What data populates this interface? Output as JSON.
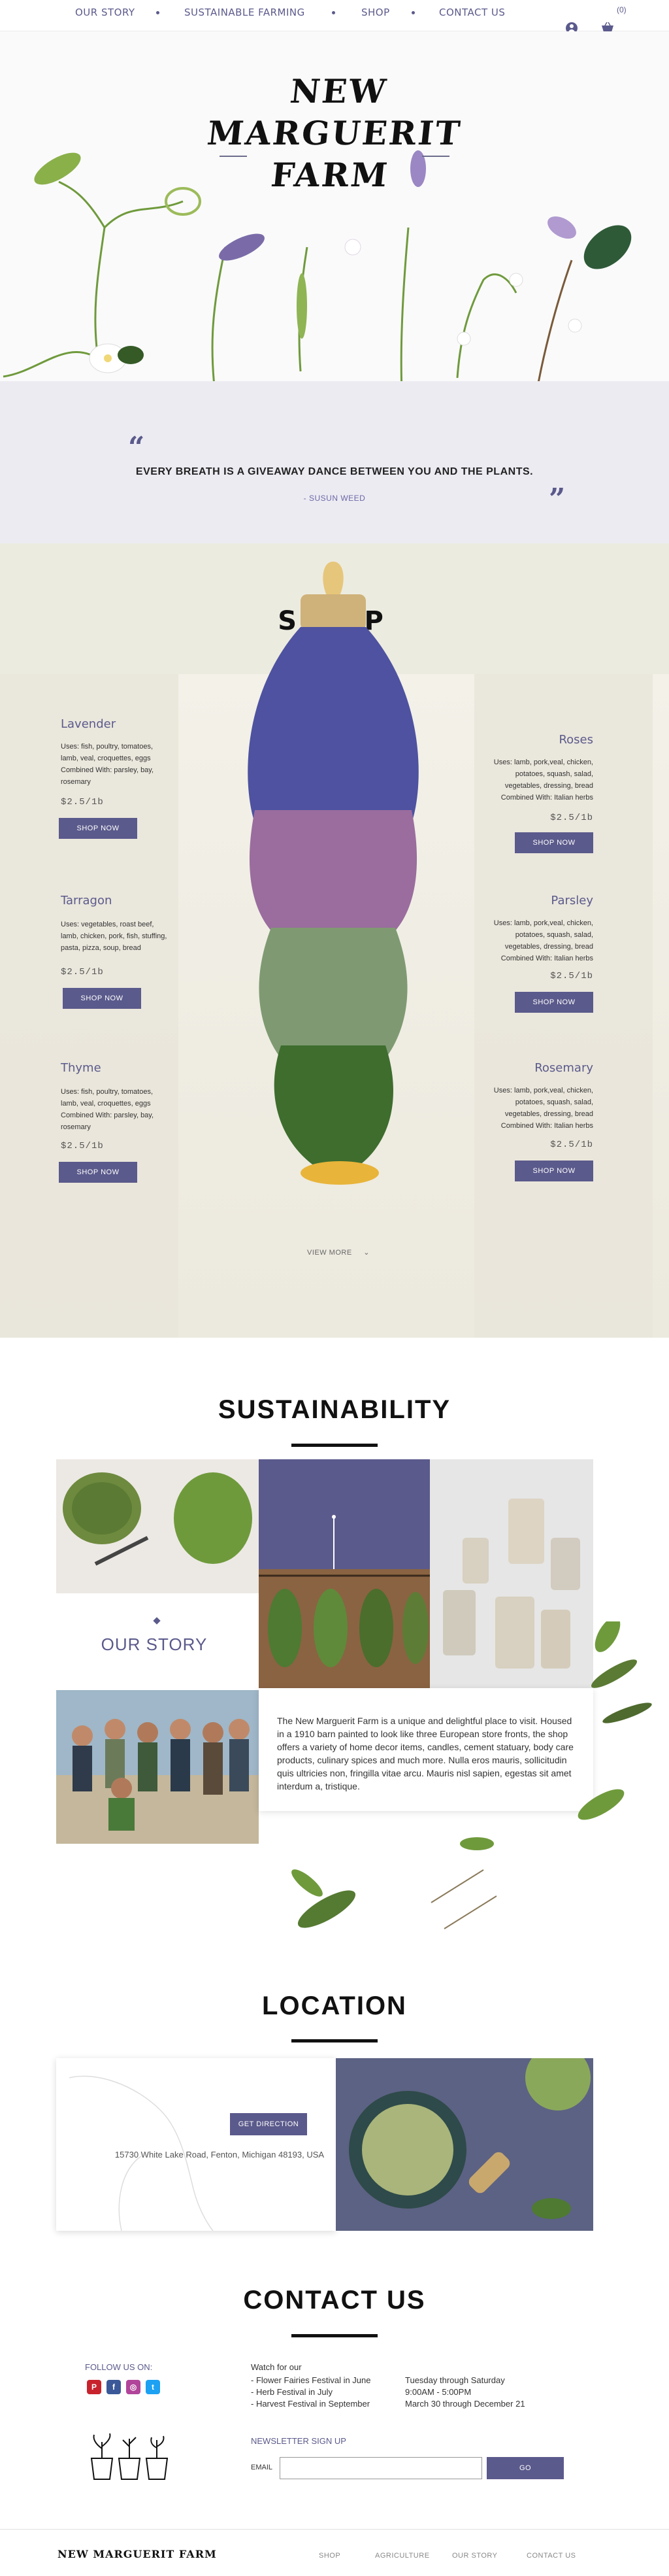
{
  "nav": {
    "items": [
      "OUR STORY",
      "SUSTAINABLE FARMING",
      "SHOP",
      "CONTACT US"
    ],
    "cart_count": "(0)",
    "icons": [
      "user-icon",
      "basket-icon"
    ],
    "accent": "#5b5a8c"
  },
  "hero": {
    "title_lines": [
      "NEW",
      "MARGUERIT",
      "FARM"
    ]
  },
  "quote": {
    "text": "EVERY BREATH IS A GIVEAWAY DANCE BETWEEN YOU AND THE PLANTS.",
    "author": "- SUSUN WEED",
    "open_mark": "“",
    "close_mark": "”"
  },
  "shop": {
    "title": "SHOP",
    "products_left": [
      {
        "name": "Lavender",
        "desc": "Uses: fish, poultry, tomatoes, lamb, veal, croquettes, eggs Combined With: parsley, bay, rosemary",
        "price": "$2.5/1b",
        "button": "SHOP NOW"
      },
      {
        "name": "Tarragon",
        "desc": "Uses: vegetables, roast beef, lamb, chicken, pork, fish, stuffing, pasta, pizza, soup, bread",
        "price": "$2.5/1b",
        "button": "SHOP NOW"
      },
      {
        "name": "Thyme",
        "desc": "Uses: fish, poultry, tomatoes, lamb, veal, croquettes, eggs Combined With: parsley, bay, rosemary",
        "price": "$2.5/1b",
        "button": "SHOP NOW"
      }
    ],
    "products_right": [
      {
        "name": "Roses",
        "desc": "Uses: lamb, pork,veal, chicken, potatoes, squash, salad, vegetables, dressing, bread Combined With: Italian herbs",
        "price": "$2.5/1b",
        "button": "SHOP NOW"
      },
      {
        "name": "Parsley",
        "desc": "Uses: lamb, pork,veal, chicken, potatoes, squash, salad, vegetables, dressing, bread Combined With: Italian herbs",
        "price": "$2.5/1b",
        "button": "SHOP NOW"
      },
      {
        "name": "Rosemary",
        "desc": "Uses: lamb, pork,veal, chicken, potatoes, squash, salad, vegetables, dressing, bread Combined With: Italian herbs",
        "price": "$2.5/1b",
        "button": "SHOP NOW"
      }
    ],
    "view_more": "VIEW MORE",
    "view_more_icon": "chevron-down-icon"
  },
  "sustainability": {
    "title": "SUSTAINABILITY",
    "story_label": "OUR STORY",
    "story_text": "The New Marguerit Farm is a unique and delightful place to visit. Housed in a 1910 barn painted to look like three European store fronts, the shop offers a variety of home decor items, candles, cement statuary, body care products, culinary spices and much more. Nulla eros mauris, sollicitudin quis ultricies non, fringilla vitae arcu. Mauris nisl sapien, egestas sit amet interdum a, tristique."
  },
  "location": {
    "title": "LOCATION",
    "button": "GET DIRECTION",
    "address": "15730 White Lake Road, Fenton, Michigan 48193, USA"
  },
  "contact": {
    "title": "CONTACT US",
    "follow_label": "FOLLOW US ON:",
    "social": [
      "P",
      "f",
      "◎",
      "t"
    ],
    "social_colors": [
      "#c8232c",
      "#3b5998",
      "#b1459a",
      "#1da1f2"
    ],
    "watch_label": "Watch for our",
    "events": [
      "- Flower Fairies Festival in June",
      "- Herb Festival in July",
      "- Harvest Festival in September"
    ],
    "hours": [
      "Tuesday through Saturday",
      "9:00AM - 5:00PM",
      "March 30 through December 21"
    ],
    "newsletter_label": "NEWSLETTER SIGN UP",
    "email_label": "EMAIL",
    "email_value": "",
    "go_button": "GO"
  },
  "footer": {
    "logo": "NEW MARGUERIT FARM",
    "links": [
      "SHOP",
      "AGRICULTURE",
      "OUR STORY",
      "CONTACT US"
    ]
  }
}
